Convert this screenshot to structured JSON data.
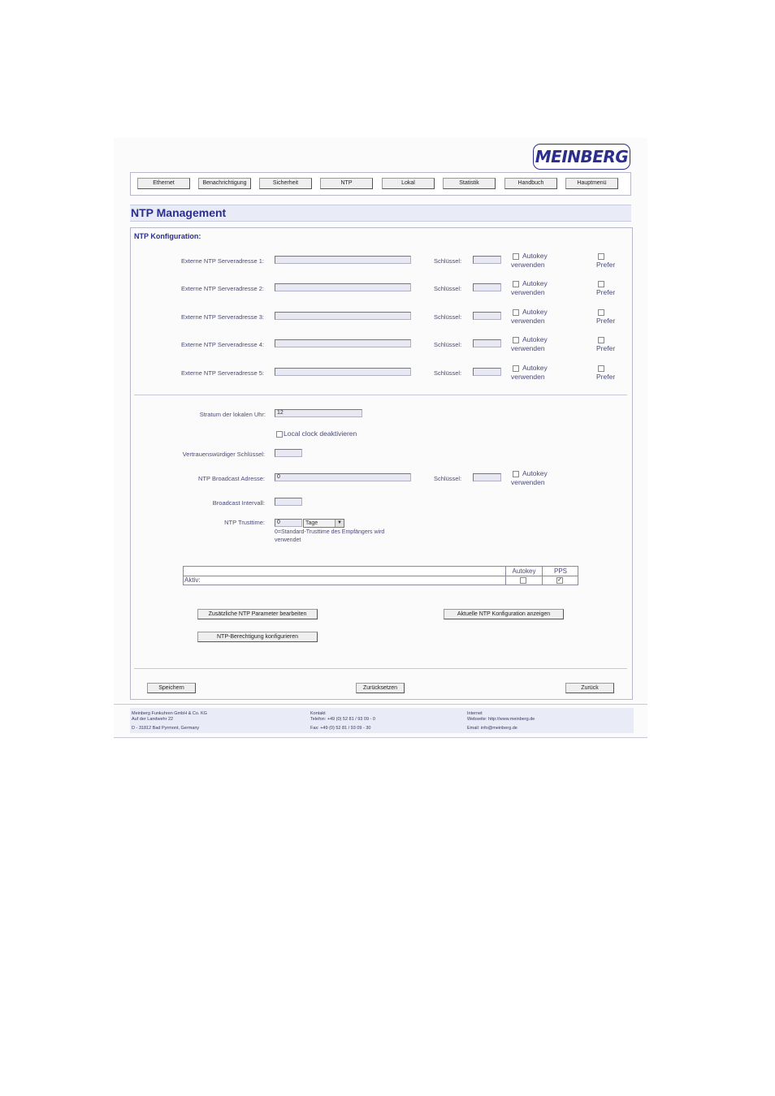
{
  "brand": {
    "logo_text": "MEINBERG"
  },
  "nav": {
    "items": [
      "Ethernet",
      "Benachrichtigung",
      "Sicherheit",
      "NTP",
      "Lokal",
      "Statistik",
      "Handbuch",
      "Hauptmenü"
    ]
  },
  "page": {
    "title": "NTP Management",
    "section_title": "NTP Konfiguration:"
  },
  "servers": [
    {
      "label": "Externe NTP Serveradresse 1:",
      "value": "",
      "key_label": "Schlüssel:",
      "key_value": "",
      "autokey_line1": "Autokey",
      "autokey_line2": "verwenden",
      "prefer_label": "Prefer"
    },
    {
      "label": "Externe NTP Serveradresse 2:",
      "value": "",
      "key_label": "Schlüssel:",
      "key_value": "",
      "autokey_line1": "Autokey",
      "autokey_line2": "verwenden",
      "prefer_label": "Prefer"
    },
    {
      "label": "Externe NTP Serveradresse 3:",
      "value": "",
      "key_label": "Schlüssel:",
      "key_value": "",
      "autokey_line1": "Autokey",
      "autokey_line2": "verwenden",
      "prefer_label": "Prefer"
    },
    {
      "label": "Externe NTP Serveradresse 4:",
      "value": "",
      "key_label": "Schlüssel:",
      "key_value": "",
      "autokey_line1": "Autokey",
      "autokey_line2": "verwenden",
      "prefer_label": "Prefer"
    },
    {
      "label": "Externe NTP Serveradresse 5:",
      "value": "",
      "key_label": "Schlüssel:",
      "key_value": "",
      "autokey_line1": "Autokey",
      "autokey_line2": "verwenden",
      "prefer_label": "Prefer"
    }
  ],
  "local": {
    "stratum_label": "Stratum der lokalen Uhr:",
    "stratum_value": "12",
    "local_clock_label": "Local clock deaktivieren",
    "trusted_key_label": "Vertrauenswürdiger Schlüssel:",
    "trusted_key_value": "",
    "broadcast_addr_label": "NTP Broadcast Adresse:",
    "broadcast_addr_value": "0",
    "broadcast_key_label": "Schlüssel:",
    "broadcast_key_value": "",
    "broadcast_autokey_line1": "Autokey",
    "broadcast_autokey_line2": "verwenden",
    "broadcast_interval_label": "Broadcast Intervall:",
    "broadcast_interval_value": "",
    "trusttime_label": "NTP Trusttime:",
    "trusttime_value": "0",
    "trusttime_unit": "Tage",
    "trusttime_hint_line1": "0=Standard-Trusttime des Empfängers wird",
    "trusttime_hint_line2": "verwendet"
  },
  "table": {
    "col_autokey": "Autokey",
    "col_pps": "PPS",
    "row_label": "Aktiv:",
    "autokey_checked": false,
    "pps_checked": true
  },
  "buttons": {
    "extra_params": "Zusätzliche NTP Parameter bearbeiten",
    "show_config": "Aktuelle NTP Konfiguration anzeigen",
    "permissions": "NTP-Berechtigung konfigurieren",
    "save": "Speichern",
    "reset": "Zurücksetzen",
    "back": "Zurück"
  },
  "footer": {
    "company": "Meinberg Funkuhren GmbH & Co. KG",
    "street": "Auf der Landwehr 22",
    "city": "D - 31812 Bad Pyrmont, Germany",
    "contact_title": "Kontakt",
    "phone": "Telefon: +49 (0) 52 81 / 93 09 - 0",
    "fax": "Fax: +49 (0) 52 81 / 93 09 - 30",
    "internet_title": "Internet",
    "website": "Webseite: http://www.meinberg.de",
    "email": "Email: info@meinberg.de"
  }
}
